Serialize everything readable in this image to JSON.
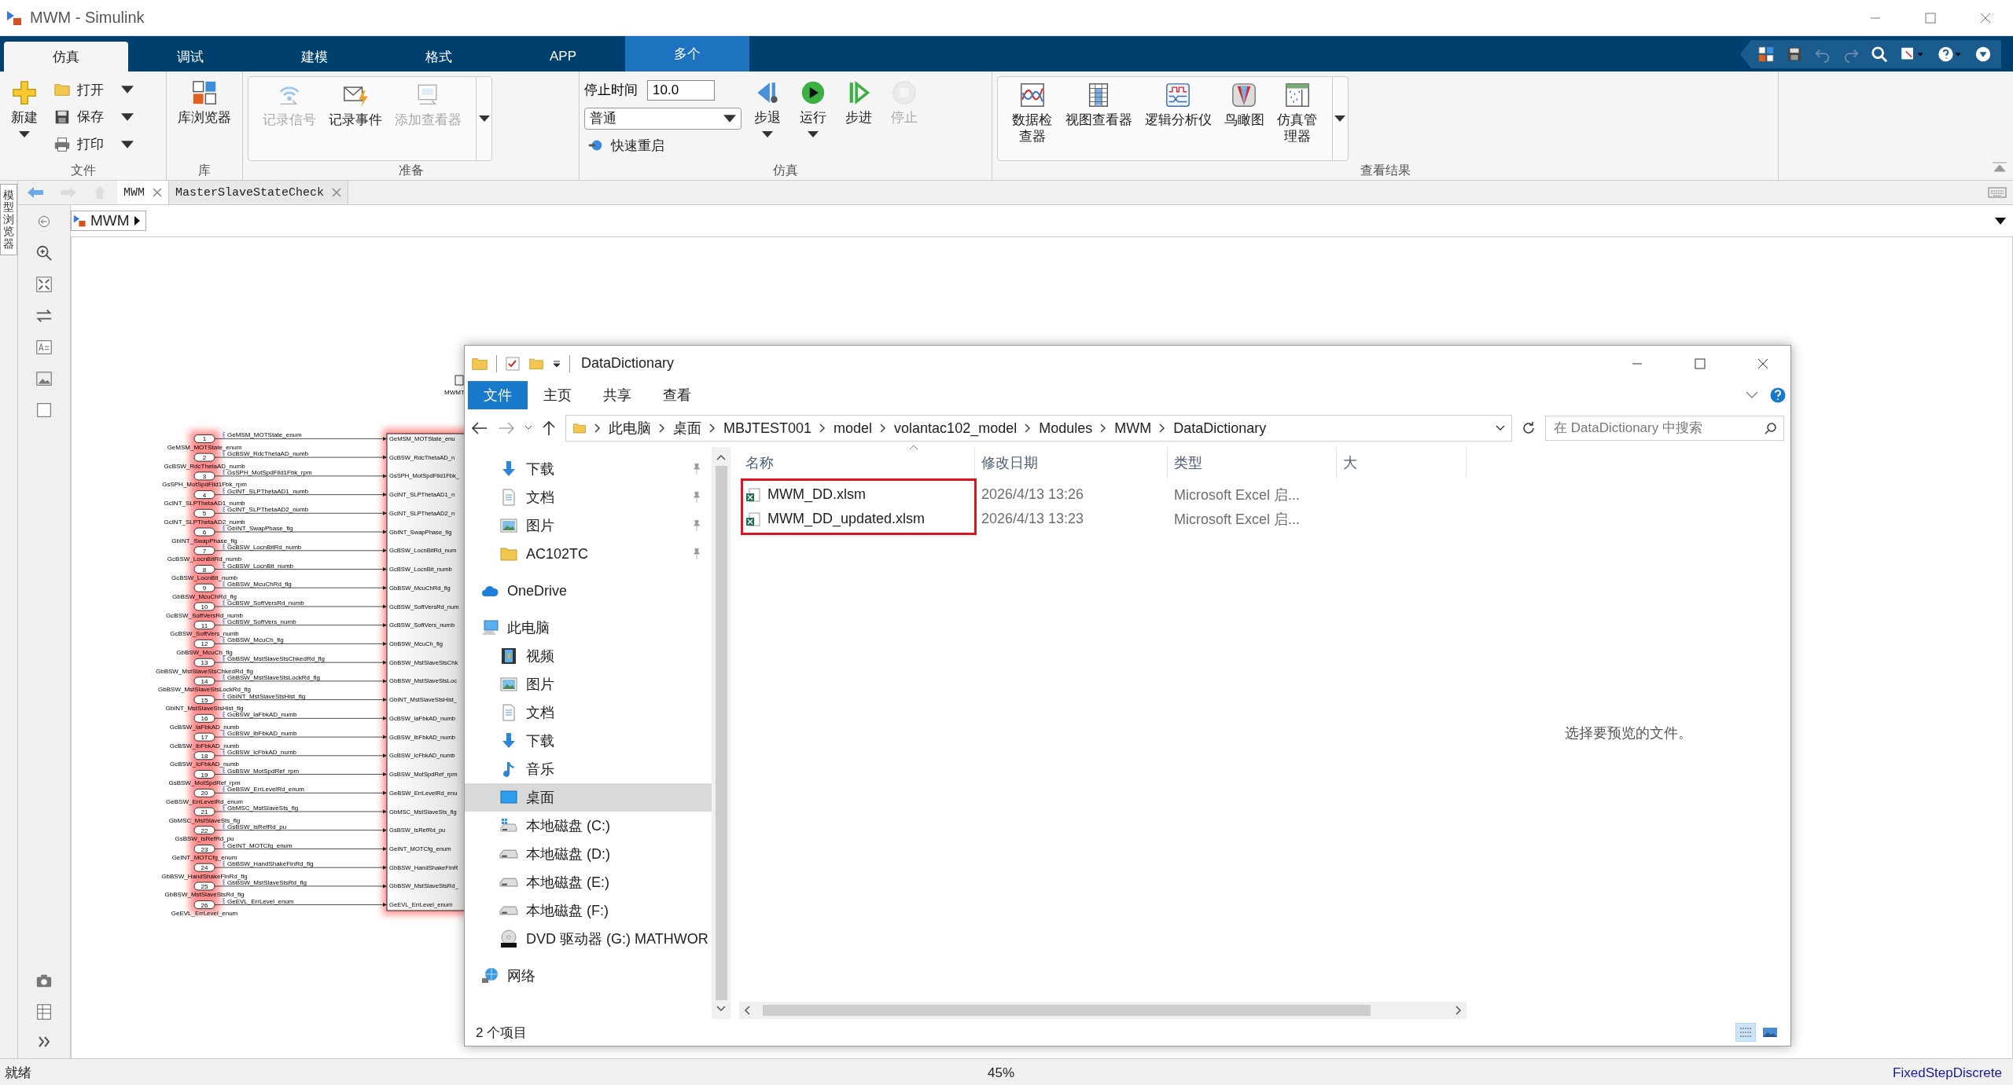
{
  "window": {
    "title": "MWM - Simulink"
  },
  "toolstrip_tabs": [
    {
      "label": "仿真",
      "selected": true,
      "kind": "normal"
    },
    {
      "label": "调试",
      "selected": false,
      "kind": "normal"
    },
    {
      "label": "建模",
      "selected": false,
      "kind": "normal"
    },
    {
      "label": "格式",
      "selected": false,
      "kind": "normal"
    },
    {
      "label": "APP",
      "selected": false,
      "kind": "normal"
    },
    {
      "label": "多个",
      "selected": false,
      "kind": "contextual"
    }
  ],
  "ribbon_sections": [
    {
      "title": "文件",
      "gallery": false,
      "controls": [
        {
          "kind": "large",
          "label": "新建",
          "dropdown": true,
          "disabled": false
        },
        {
          "kind": "small",
          "label": "打开",
          "dropdown": true,
          "disabled": false
        },
        {
          "kind": "small",
          "label": "保存",
          "dropdown": true,
          "disabled": false
        },
        {
          "kind": "small",
          "label": "打印",
          "dropdown": true,
          "disabled": false
        }
      ]
    },
    {
      "title": "库",
      "gallery": false,
      "controls": [
        {
          "kind": "large",
          "label": "库浏览器",
          "dropdown": false,
          "disabled": false
        }
      ]
    },
    {
      "title": "准备",
      "gallery": true,
      "controls": [
        {
          "kind": "large",
          "label": "记录信号",
          "dropdown": false,
          "disabled": true
        },
        {
          "kind": "large",
          "label": "记录事件",
          "dropdown": false,
          "disabled": false
        },
        {
          "kind": "large",
          "label": "添加查看器",
          "dropdown": false,
          "disabled": true
        }
      ]
    },
    {
      "title": "仿真",
      "gallery": false,
      "controls": [
        {
          "kind": "field",
          "label": "停止时间",
          "value": "10.0"
        },
        {
          "kind": "select",
          "value": "普通"
        },
        {
          "kind": "small",
          "label": "快速重启",
          "dropdown": false,
          "disabled": false
        },
        {
          "kind": "large",
          "label": "步退",
          "dropdown": true,
          "disabled": false
        },
        {
          "kind": "large",
          "label": "运行",
          "dropdown": true,
          "disabled": false
        },
        {
          "kind": "large",
          "label": "步进",
          "dropdown": false,
          "disabled": false
        },
        {
          "kind": "large",
          "label": "停止",
          "dropdown": false,
          "disabled": true
        }
      ]
    },
    {
      "title": "查看结果",
      "gallery": true,
      "controls": [
        {
          "kind": "large",
          "label": "数据检查器",
          "dropdown": false,
          "disabled": false
        },
        {
          "kind": "large",
          "label": "视图查看器",
          "dropdown": false,
          "disabled": false
        },
        {
          "kind": "large",
          "label": "逻辑分析仪",
          "dropdown": false,
          "disabled": false
        },
        {
          "kind": "large",
          "label": "鸟瞰图",
          "dropdown": false,
          "disabled": false
        },
        {
          "kind": "large",
          "label": "仿真管理器",
          "dropdown": false,
          "disabled": false
        }
      ]
    }
  ],
  "model_browser": {
    "label": "模型浏览器"
  },
  "editor_tabs": [
    {
      "label": "MWM",
      "selected": true
    },
    {
      "label": "MasterSlaveStateCheck",
      "selected": false
    }
  ],
  "breadcrumb": "MWM",
  "diagram": {
    "block_label": "MWMT",
    "ports": [
      {
        "number": "1",
        "name": "GeMSM_MOTState_enum",
        "signal": "GeMSM_MOTState_enum",
        "input": "GeMSM_MOTState_enu"
      },
      {
        "number": "2",
        "name": "GcBSW_RdcThetaAD_numb",
        "signal": "GcBSW_RdcThetaAD_numb",
        "input": "GcBSW_RdcThetaAD_n"
      },
      {
        "number": "3",
        "name": "GsSPH_MotSpdFild1Fbk_rpm",
        "signal": "GsSPH_MotSpdFild1Fbk_rpm",
        "input": "GsSPH_MotSpdFild1Fbk_"
      },
      {
        "number": "4",
        "name": "GcINT_SLPThetaAD1_numb",
        "signal": "GcINT_SLPThetaAD1_numb",
        "input": "GcINT_SLPThetaAD1_n"
      },
      {
        "number": "5",
        "name": "GcINT_SLPThetaAD2_numb",
        "signal": "GcINT_SLPThetaAD2_numb",
        "input": "GcINT_SLPThetaAD2_n"
      },
      {
        "number": "6",
        "name": "GbINT_SwapPhase_flg",
        "signal": "GbINT_SwapPhase_flg",
        "input": "GbINT_SwapPhase_flg"
      },
      {
        "number": "7",
        "name": "GcBSW_LocnBitRd_numb",
        "signal": "GcBSW_LocnBitRd_numb",
        "input": "GcBSW_LocnBitRd_num"
      },
      {
        "number": "8",
        "name": "GcBSW_LocnBit_numb",
        "signal": "GcBSW_LocnBit_numb",
        "input": "GcBSW_LocnBit_numb"
      },
      {
        "number": "9",
        "name": "GbBSW_McuChRd_flg",
        "signal": "GbBSW_McuChRd_flg",
        "input": "GbBSW_McuChRd_flg"
      },
      {
        "number": "10",
        "name": "GcBSW_SoftVersRd_numb",
        "signal": "GcBSW_SoftVersRd_numb",
        "input": "GcBSW_SoftVersRd_num"
      },
      {
        "number": "11",
        "name": "GcBSW_SoftVers_numb",
        "signal": "GcBSW_SoftVers_numb",
        "input": "GcBSW_SoftVers_numb"
      },
      {
        "number": "12",
        "name": "GbBSW_McuCh_flg",
        "signal": "GbBSW_McuCh_flg",
        "input": "GbBSW_McuCh_flg"
      },
      {
        "number": "13",
        "name": "GbBSW_MstSlaveStsChkedRd_flg",
        "signal": "GbBSW_MstSlaveStsChkedRd_flg",
        "input": "GbBSW_MstSlaveStsChk"
      },
      {
        "number": "14",
        "name": "GbBSW_MstSlaveStsLockRd_flg",
        "signal": "GbBSW_MstSlaveStsLockRd_flg",
        "input": "GbBSW_MstSlaveStsLoc"
      },
      {
        "number": "15",
        "name": "GbINT_MstSlaveStsHist_flg",
        "signal": "GbINT_MstSlaveStsHist_flg",
        "input": "GbINT_MstSlaveStsHist_"
      },
      {
        "number": "16",
        "name": "GcBSW_IaFbkAD_numb",
        "signal": "GcBSW_IaFbkAD_numb",
        "input": "GcBSW_IaFbkAD_numb"
      },
      {
        "number": "17",
        "name": "GcBSW_IbFbkAD_numb",
        "signal": "GcBSW_IbFbkAD_numb",
        "input": "GcBSW_IbFbkAD_numb"
      },
      {
        "number": "18",
        "name": "GcBSW_IcFbkAD_numb",
        "signal": "GcBSW_IcFbkAD_numb",
        "input": "GcBSW_IcFbkAD_numb"
      },
      {
        "number": "19",
        "name": "GsBSW_MotSpdRef_rpm",
        "signal": "GsBSW_MotSpdRef_rpm",
        "input": "GsBSW_MotSpdRef_rpm"
      },
      {
        "number": "20",
        "name": "GeBSW_ErrLevelRd_enum",
        "signal": "GeBSW_ErrLevelRd_enum",
        "input": "GeBSW_ErrLevelRd_enu"
      },
      {
        "number": "21",
        "name": "GbMSC_MstSlaveSts_flg",
        "signal": "GbMSC_MstSlaveSts_flg",
        "input": "GbMSC_MstSlaveSts_flg"
      },
      {
        "number": "22",
        "name": "GsBSW_IsRefRd_pu",
        "signal": "GsBSW_IsRefRd_pu",
        "input": "GsBSW_IsRefRd_pu"
      },
      {
        "number": "23",
        "name": "GeINT_MOTCfg_enum",
        "signal": "GeINT_MOTCfg_enum",
        "input": "GeINT_MOTCfg_enum"
      },
      {
        "number": "24",
        "name": "GbBSW_HandShakeFinRd_flg",
        "signal": "GbBSW_HandShakeFinRd_flg",
        "input": "GbBSW_HandShakeFinR"
      },
      {
        "number": "25",
        "name": "GbBSW_MstSlaveStsRd_flg",
        "signal": "GbBSW_MstSlaveStsRd_flg",
        "input": "GbBSW_MstSlaveStsRd_"
      },
      {
        "number": "26",
        "name": "GeEVL_ErrLevel_enum",
        "signal": "GeEVL_ErrLevel_enum",
        "input": "GeEVL_ErrLevel_enum"
      }
    ]
  },
  "explorer": {
    "title": "DataDictionary",
    "ribbon_tabs": [
      {
        "label": "文件",
        "selected": true
      },
      {
        "label": "主页",
        "selected": false
      },
      {
        "label": "共享",
        "selected": false
      },
      {
        "label": "查看",
        "selected": false
      }
    ],
    "path": [
      "此电脑",
      "桌面",
      "MBJTEST001",
      "model",
      "volantac102_model",
      "Modules",
      "MWM",
      "DataDictionary"
    ],
    "search": {
      "placeholder": "在 DataDictionary 中搜索"
    },
    "quick_access": [
      {
        "label": "下载",
        "pinned": true,
        "selected": false
      },
      {
        "label": "文档",
        "pinned": true,
        "selected": false
      },
      {
        "label": "图片",
        "pinned": true,
        "selected": false
      },
      {
        "label": "AC102TC",
        "pinned": true,
        "selected": false
      }
    ],
    "nav_items": [
      {
        "label": "OneDrive",
        "selected": false
      },
      {
        "label": "此电脑",
        "selected": false,
        "children": [
          {
            "label": "视频",
            "selected": false
          },
          {
            "label": "图片",
            "selected": false
          },
          {
            "label": "文档",
            "selected": false
          },
          {
            "label": "下载",
            "selected": false
          },
          {
            "label": "音乐",
            "selected": false
          },
          {
            "label": "桌面",
            "selected": true
          },
          {
            "label": "本地磁盘 (C:)",
            "selected": false
          },
          {
            "label": "本地磁盘 (D:)",
            "selected": false
          },
          {
            "label": "本地磁盘 (E:)",
            "selected": false
          },
          {
            "label": "本地磁盘 (F:)",
            "selected": false
          },
          {
            "label": "DVD 驱动器 (G:) MATHWOR",
            "selected": false
          }
        ]
      },
      {
        "label": "网络",
        "selected": false
      }
    ],
    "columns": [
      "名称",
      "修改日期",
      "类型",
      "大"
    ],
    "files": [
      {
        "name": "MWM_DD.xlsm",
        "modified": "2026/4/13 13:26",
        "type": "Microsoft Excel 启..."
      },
      {
        "name": "MWM_DD_updated.xlsm",
        "modified": "2026/4/13 13:23",
        "type": "Microsoft Excel 启..."
      }
    ],
    "files_marked": true,
    "preview_text": "选择要预览的文件。",
    "status": "2 个项目"
  },
  "status_bar": {
    "state": "就绪",
    "zoom": "45%",
    "solver": "FixedStepDiscrete"
  }
}
